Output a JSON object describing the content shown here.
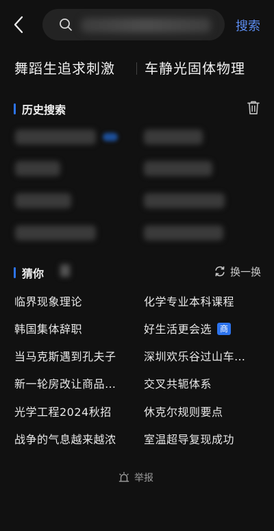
{
  "header": {
    "back_icon": "chevron-left-icon",
    "search_icon": "search-icon",
    "search_value": "",
    "search_button_label": "搜索",
    "accent_color": "#5b8cf0"
  },
  "hot": {
    "left": "舞蹈生追求刺激",
    "right": "车静光固体物理"
  },
  "history": {
    "title": "历史搜索",
    "trash_icon": "trash-icon",
    "bar_color": "#2d74ee"
  },
  "guess": {
    "title": "猜你",
    "refresh_icon": "refresh-icon",
    "refresh_label": "换一换",
    "items_left": [
      "临界现象理论",
      "韩国集体辞职",
      "当马克斯遇到孔夫子",
      "新一轮房改让商品…",
      "光学工程2024秋招",
      "战争的气息越来越浓"
    ],
    "items_right": [
      "化学专业本科课程",
      "好生活更会选",
      "深圳欢乐谷过山车…",
      "交叉共轭体系",
      "休克尔规则要点",
      "室温超导复现成功"
    ],
    "badge": "商"
  },
  "footer": {
    "report_icon": "report-alarm-icon",
    "report_label": "举报"
  }
}
